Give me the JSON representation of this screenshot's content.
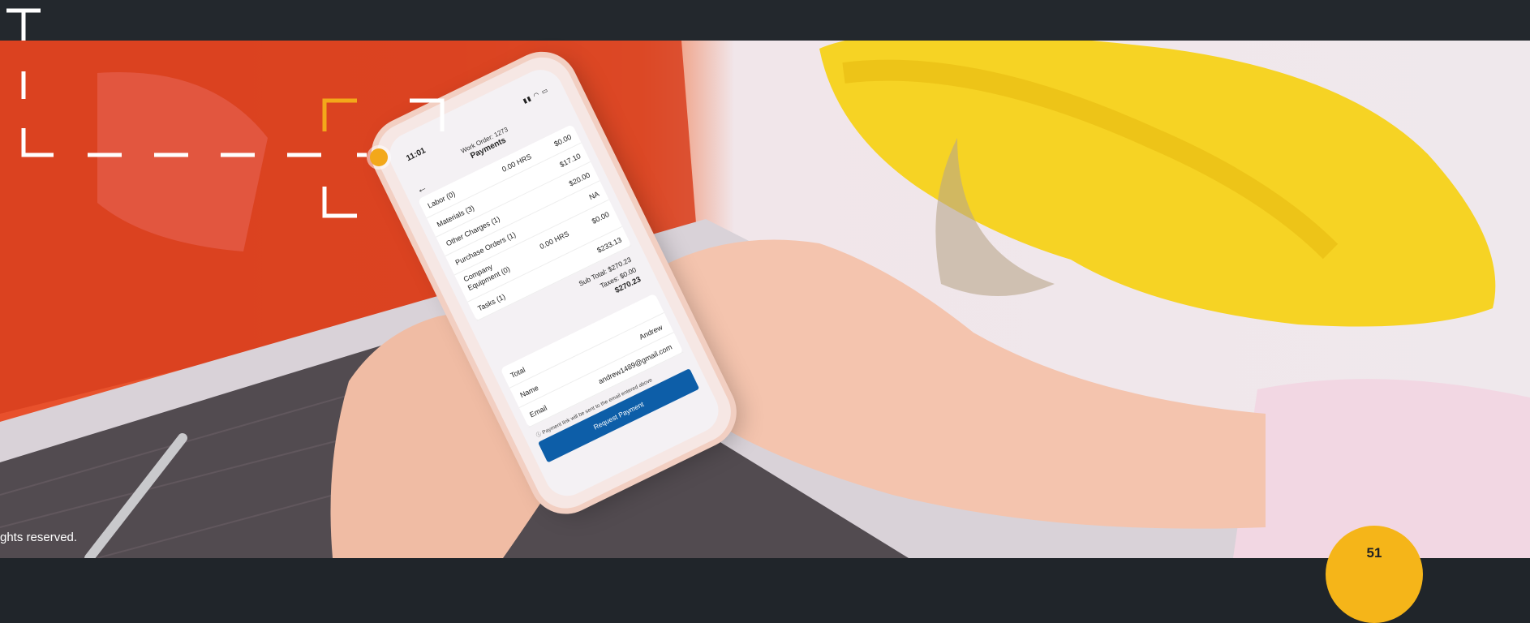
{
  "phone": {
    "time": "11:01",
    "status_icons": "▮▮ ◠ ▭",
    "work_order": "Work Order: 1273",
    "title": "Payments",
    "back_glyph": "←",
    "rows": [
      {
        "label": "Labor (0)",
        "mid": "0.00 HRS",
        "value": "$0.00"
      },
      {
        "label": "Materials (3)",
        "mid": "",
        "value": "$17.10"
      },
      {
        "label": "Other Charges (1)",
        "mid": "",
        "value": "$20.00"
      },
      {
        "label": "Purchase Orders (1)",
        "mid": "",
        "value": "NA"
      },
      {
        "label": "Company Equipment (0)",
        "mid": "0.00 HRS",
        "value": "$0.00"
      },
      {
        "label": "Tasks (1)",
        "mid": "",
        "value": "$233.13"
      }
    ],
    "sub_total": "Sub Total: $270.23",
    "taxes": "Taxes: $0.00",
    "grand_total": "$270.23",
    "total_label": "Total",
    "name_label": "Name",
    "name_value": "Andrew",
    "email_label": "Email",
    "email_value": "andrew1489@gmail.com",
    "note": "ⓘ Payment link will be sent to the email entered above",
    "button_label": "Request Payment"
  },
  "footer": {
    "copyright": "ghts reserved.",
    "page_number": "51"
  },
  "colors": {
    "topbar": "#23282d",
    "accent_orange": "#f3a81a",
    "badge": "#f5b519",
    "button_blue": "#0d5ea8"
  }
}
